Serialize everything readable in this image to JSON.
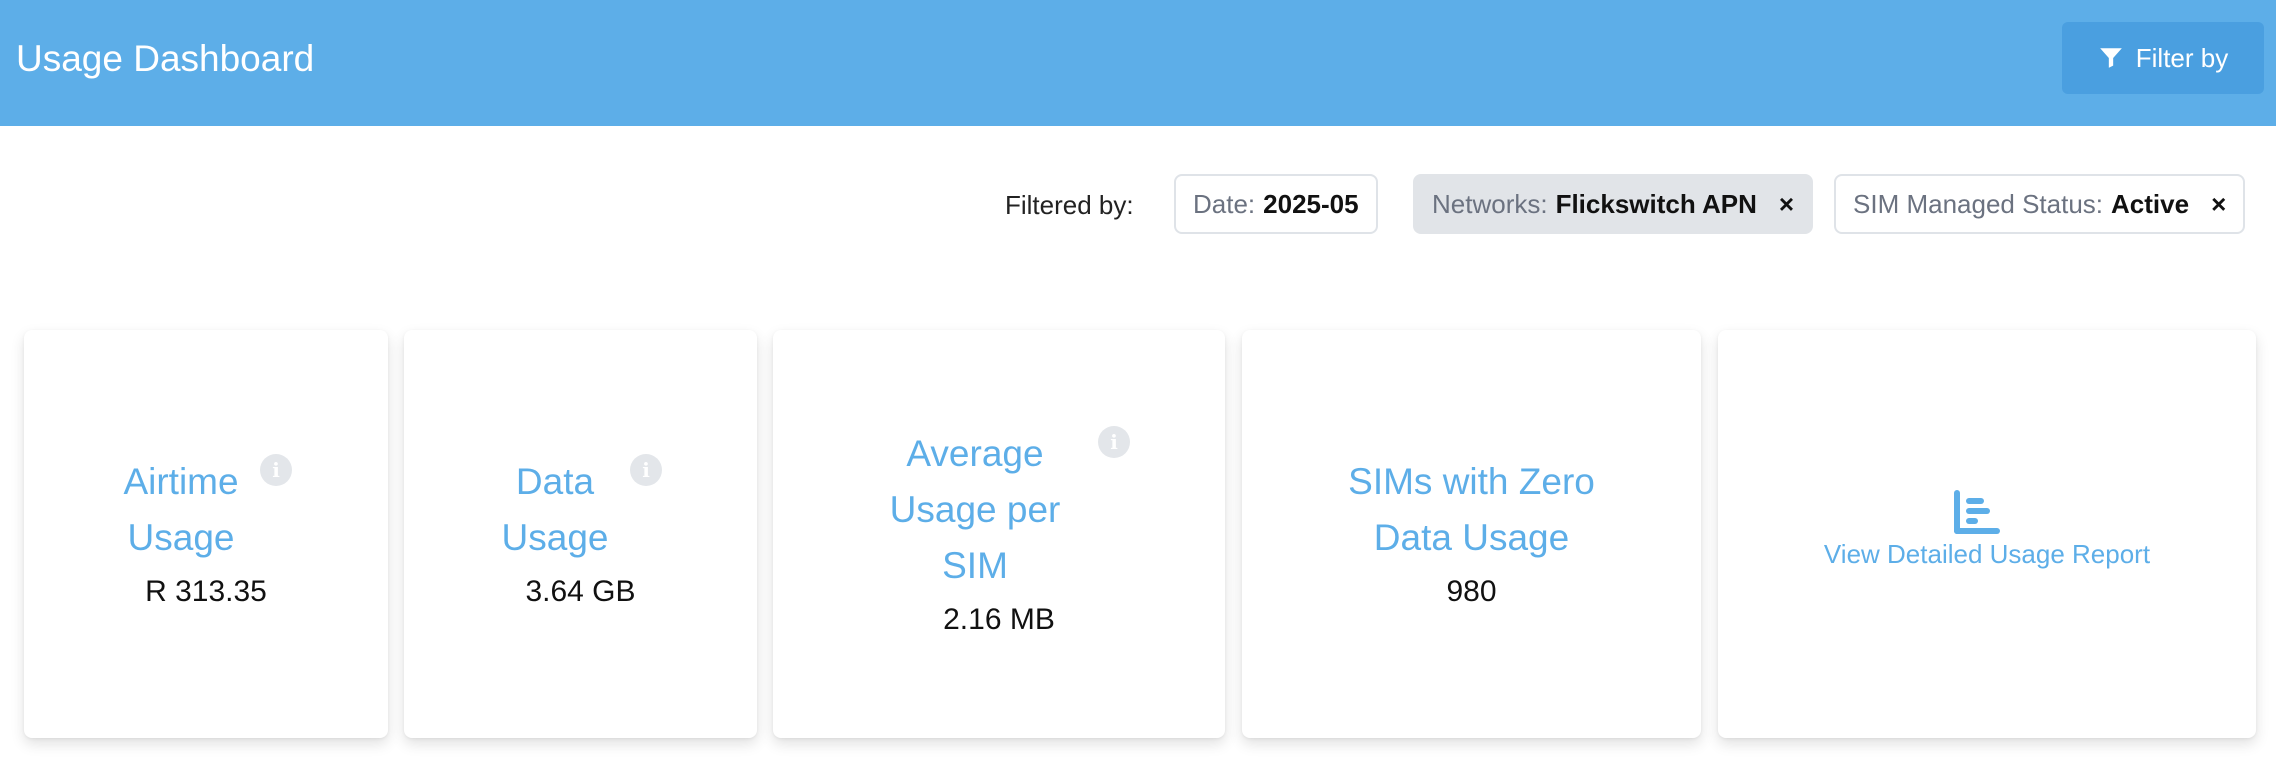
{
  "header": {
    "title": "Usage Dashboard",
    "filter_button_label": "Filter by"
  },
  "filters": {
    "label": "Filtered by:",
    "chips": [
      {
        "key": "Date:",
        "value": "2025-05",
        "removable": false,
        "active": false
      },
      {
        "key": "Networks:",
        "value": "Flickswitch APN",
        "removable": true,
        "active": true
      },
      {
        "key": "SIM Managed Status:",
        "value": "Active",
        "removable": true,
        "active": false
      }
    ],
    "remove_glyph": "×"
  },
  "cards": {
    "airtime": {
      "title_line1": "Airtime",
      "title_line2": "Usage",
      "value": "R 313.35",
      "info_glyph": "i"
    },
    "data": {
      "title_line1": "Data",
      "title_line2": "Usage",
      "value": "3.64 GB",
      "info_glyph": "i"
    },
    "average": {
      "title_line1": "Average",
      "title_line2": "Usage per",
      "title_line3": "SIM",
      "value": "2.16 MB",
      "info_glyph": "i"
    },
    "zero": {
      "title_line1": "SIMs with Zero",
      "title_line2": "Data Usage",
      "value": "980"
    },
    "report": {
      "link_label": "View Detailed Usage Report",
      "icon": "bar-chart-icon"
    }
  },
  "colors": {
    "header_bg": "#5daee8",
    "filter_button_bg": "#4a9fe0",
    "accent": "#5daee8",
    "chip_active_bg": "#e1e4e8"
  }
}
